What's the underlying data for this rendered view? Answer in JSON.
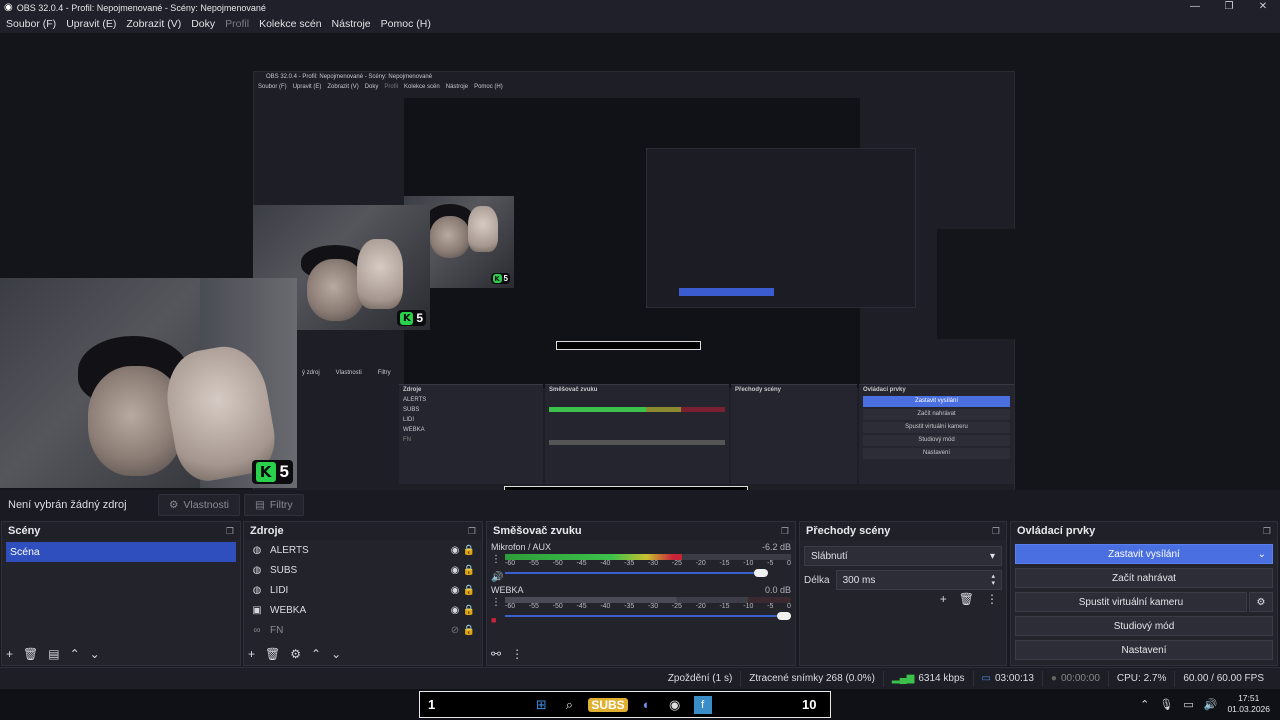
{
  "window": {
    "title": "OBS 32.0.4 - Profil: Nepojmenované - Scény: Nepojmenované"
  },
  "menu": [
    "Soubor (F)",
    "Upravit (E)",
    "Zobrazit (V)",
    "Doky",
    "Profil",
    "Kolekce scén",
    "Nástroje",
    "Pomoc (H)"
  ],
  "preview": {
    "badge_number": "5",
    "nested_title": "OBS 32.0.4 - Profil: Nepojmenované - Scény: Nepojmenované",
    "nested_menu": [
      "Soubor (F)",
      "Upravit (E)",
      "Zobrazit (V)",
      "Doky",
      "Profil",
      "Kolekce scén",
      "Nástroje",
      "Pomoc (H)"
    ],
    "nested_panels": {
      "sources_title": "Zdroje",
      "sources": [
        "ALERTS",
        "SUBS",
        "LIDI",
        "WEBKA",
        "FN"
      ],
      "mixer_title": "Směšovač zvuku",
      "transitions_title": "Přechody scény",
      "controls_title": "Ovládací prvky",
      "controls": [
        "Zastavit vysílání",
        "Začít nahrávat",
        "Spustit virtuální kameru",
        "Studiový mód",
        "Nastavení"
      ],
      "props_fragment": "ý zdroj",
      "props": "Vlastnosti",
      "filters": "Filtry"
    }
  },
  "source_toolbar": {
    "label": "Není vybrán žádný zdroj",
    "properties": "Vlastnosti",
    "filters": "Filtry"
  },
  "scenes": {
    "title": "Scény",
    "items": [
      "Scéna"
    ]
  },
  "sources": {
    "title": "Zdroje",
    "items": [
      {
        "name": "ALERTS",
        "icon": "browser-icon"
      },
      {
        "name": "SUBS",
        "icon": "browser-icon"
      },
      {
        "name": "LIDI",
        "icon": "browser-icon"
      },
      {
        "name": "WEBKA",
        "icon": "camera-icon"
      },
      {
        "name": "FN",
        "icon": "link-icon"
      }
    ]
  },
  "mixer": {
    "title": "Směšovač zvuku",
    "channels": [
      {
        "name": "Mikrofon / AUX",
        "db": "-6.2 dB",
        "level": 0.62,
        "volume": 0.92
      },
      {
        "name": "WEBKA",
        "db": "0.0 dB",
        "level": 0.0,
        "volume": 1.0
      }
    ],
    "scale": [
      "-60",
      "-55",
      "-50",
      "-45",
      "-40",
      "-35",
      "-30",
      "-25",
      "-20",
      "-15",
      "-10",
      "-5",
      "0"
    ]
  },
  "transitions": {
    "title": "Přechody scény",
    "type": "Slábnutí",
    "duration_label": "Délka",
    "duration": "300 ms"
  },
  "controls": {
    "title": "Ovládací prvky",
    "stop_stream": "Zastavit vysílání",
    "start_record": "Začít nahrávat",
    "virtual_cam": "Spustit virtuální kameru",
    "studio": "Studiový mód",
    "settings": "Nastavení"
  },
  "status": {
    "delay": "Zpoždění (1 s)",
    "dropped": "Ztracené snímky 268 (0.0%)",
    "kbps": "6314 kbps",
    "stream_time": "03:00:13",
    "rec_time": "00:00:00",
    "cpu": "CPU: 2.7%",
    "fps": "60.00 / 60.00 FPS"
  },
  "taskbar": {
    "left_num": "1",
    "right_num": "10",
    "subs_label": "SUBS",
    "time": "17:51",
    "date": "01.03.2026"
  },
  "colors": {
    "accent": "#4a6fe0",
    "scene_selected": "#2f4fbf",
    "meter_green": "#3cc24a",
    "meter_red": "#c8243a"
  }
}
